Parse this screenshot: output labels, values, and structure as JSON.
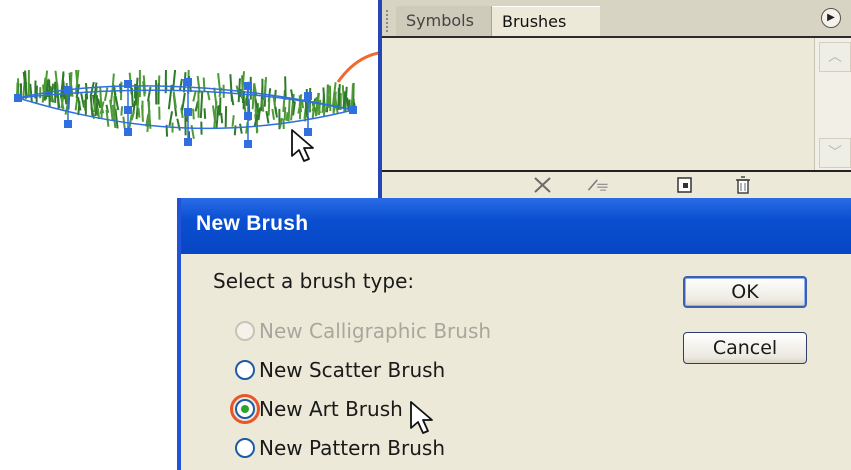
{
  "brushes_panel": {
    "tabs": [
      {
        "label": "Symbols",
        "active": false
      },
      {
        "label": "Brushes",
        "active": true
      }
    ],
    "menu_icon": "panel-menu-icon",
    "footer_icons": [
      "remove-brush-stroke-icon",
      "brush-options-icon",
      "new-brush-icon",
      "delete-brush-icon"
    ]
  },
  "dialog": {
    "title": "New Brush",
    "prompt": "Select a brush type:",
    "options": [
      {
        "label": "New Calligraphic Brush",
        "enabled": false,
        "selected": false
      },
      {
        "label": "New Scatter Brush",
        "enabled": true,
        "selected": false
      },
      {
        "label": "New Art Brush",
        "enabled": true,
        "selected": true
      },
      {
        "label": "New Pattern Brush",
        "enabled": true,
        "selected": false
      }
    ],
    "buttons": {
      "ok": "OK",
      "cancel": "Cancel"
    }
  },
  "colors": {
    "titlebar": "#0a4fd0",
    "dialog_bg": "#ece9d8",
    "selection_halo": "#e8552b",
    "grass": "#2f7a2a",
    "selection_handles": "#2f6fe0"
  }
}
